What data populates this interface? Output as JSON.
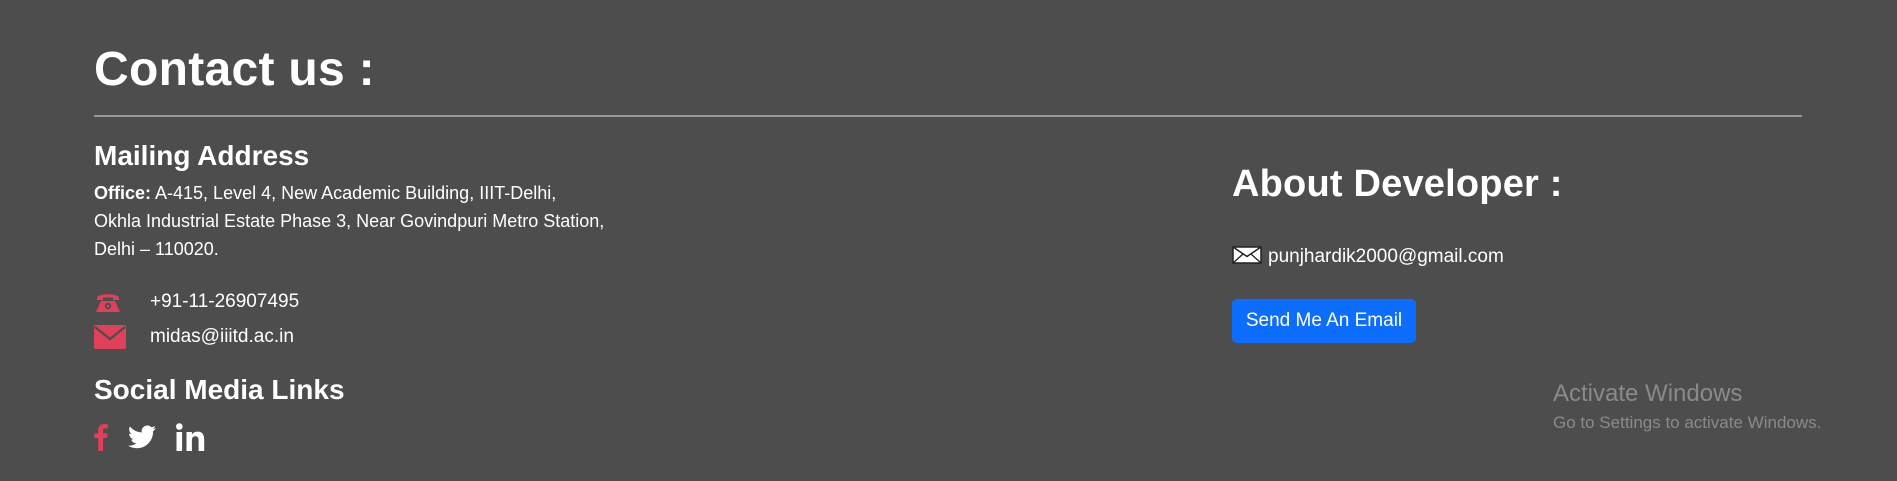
{
  "contact": {
    "heading": "Contact us :"
  },
  "mailing": {
    "title": "Mailing Address",
    "office_label": "Office:",
    "address_line1": " A-415, Level 4, New Academic Building, IIIT-Delhi,",
    "address_line2": "Okhla Industrial Estate Phase 3, Near Govindpuri Metro Station,",
    "address_line3": "Delhi – 110020.",
    "phone": "+91-11-26907495",
    "email": "midas@iiitd.ac.in",
    "icon_color": "#e0405a"
  },
  "social": {
    "title": "Social Media Links",
    "links": [
      {
        "icon": "facebook-icon"
      },
      {
        "icon": "twitter-icon"
      },
      {
        "icon": "linkedin-icon"
      }
    ]
  },
  "about": {
    "title": "About Developer :",
    "email": "punjhardik2000@gmail.com",
    "button_label": "Send Me An Email",
    "button_color": "#0d6efd"
  },
  "watermark": {
    "line1": "Activate Windows",
    "line2": "Go to Settings to activate Windows."
  }
}
